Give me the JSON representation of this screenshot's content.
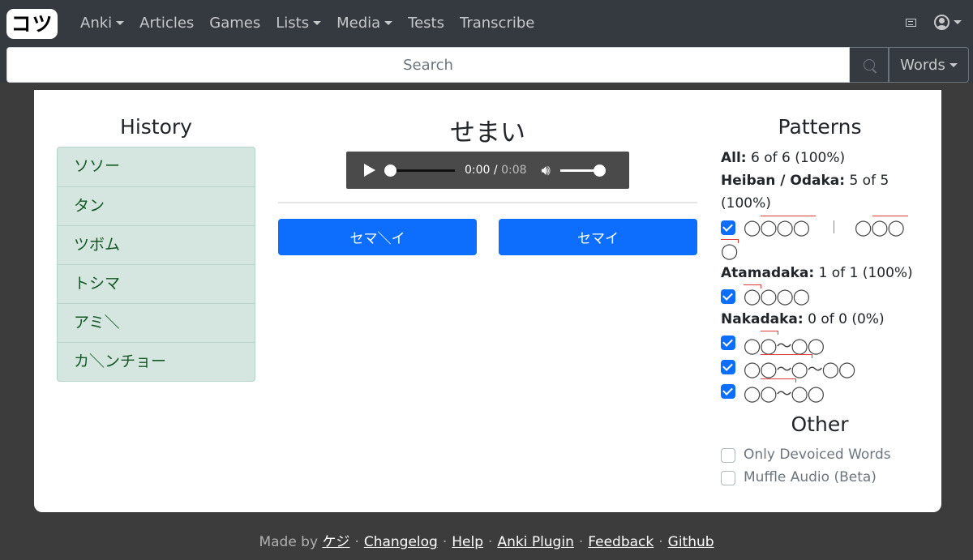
{
  "navbar": {
    "brand": "コツ",
    "items": [
      {
        "label": "Anki",
        "dropdown": true
      },
      {
        "label": "Articles",
        "dropdown": false
      },
      {
        "label": "Games",
        "dropdown": false
      },
      {
        "label": "Lists",
        "dropdown": true
      },
      {
        "label": "Media",
        "dropdown": true
      },
      {
        "label": "Tests",
        "dropdown": false
      },
      {
        "label": "Transcribe",
        "dropdown": false
      }
    ],
    "icons": [
      "newspaper-icon",
      "user-circle-icon"
    ]
  },
  "search": {
    "placeholder": "Search",
    "value": "",
    "mode": "Words"
  },
  "history": {
    "title": "History",
    "items": [
      "ソソー",
      "タン",
      "ツボム",
      "トシマ",
      "アミ＼",
      "カ＼ンチョー"
    ]
  },
  "quiz": {
    "word": "せまい",
    "audio": {
      "current": "0:00",
      "duration": "0:08"
    },
    "answers": [
      "セマ＼イ",
      "セマイ"
    ]
  },
  "patterns": {
    "title": "Patterns",
    "all": {
      "label": "All:",
      "value": "6 of 6 (100%)"
    },
    "heiban": {
      "label": "Heiban / Odaka:",
      "value": "5 of 5",
      "percent": "(100%)"
    },
    "atamadaka": {
      "label": "Atamadaka:",
      "value": "1 of 1 (100%)"
    },
    "nakadaka": {
      "label": "Nakadaka:",
      "value": "0 of 0 (0%)"
    },
    "morae": {
      "heiban_a": "◯◯◯◯",
      "heiban_sep": "|",
      "heiban_b": "◯◯◯",
      "heiban_b_tail": "◯",
      "atamadaka": "◯◯◯◯",
      "nakadaka_1": "◯◯〜◯◯",
      "nakadaka_2": "◯◯〜◯〜◯◯",
      "nakadaka_3": "◯◯〜◯◯"
    },
    "checks": [
      true,
      true,
      true,
      true,
      true
    ]
  },
  "other": {
    "title": "Other",
    "options": [
      {
        "label": "Only Devoiced Words",
        "checked": false
      },
      {
        "label": "Muffle Audio (Beta)",
        "checked": false
      }
    ]
  },
  "footer": {
    "made_by": "Made by",
    "author": "ケジ",
    "links": [
      "Changelog",
      "Help",
      "Anki Plugin",
      "Feedback",
      "Github"
    ],
    "separator": "·"
  },
  "colors": {
    "primary": "#0d6efd",
    "navbar": "#343a40",
    "history_bg": "#d4e6df",
    "pitch_line": "#e03b3b"
  }
}
